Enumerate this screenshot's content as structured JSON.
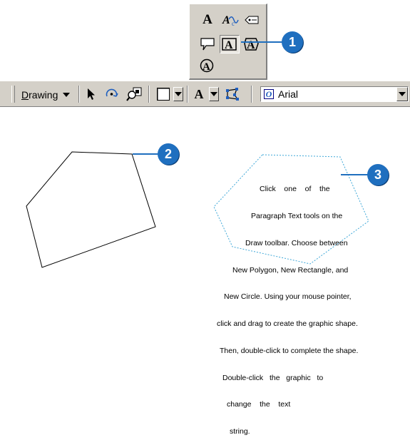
{
  "palette": {
    "tools": [
      {
        "name": "text-tool",
        "glyph": "A"
      },
      {
        "name": "spline-text-tool",
        "glyph": "A"
      },
      {
        "name": "label-tool",
        "icon": "label-tag-icon"
      },
      {
        "name": "callout-tool",
        "icon": "callout-bubble-icon"
      },
      {
        "name": "rectangle-text-tool",
        "glyph": "A",
        "pressed": true
      },
      {
        "name": "polygon-text-tool",
        "glyph": "A"
      },
      {
        "name": "circle-text-tool",
        "glyph": "A"
      }
    ]
  },
  "toolbar": {
    "drawing_label": "Drawing",
    "font_color_glyph": "A",
    "font_name": "Arial"
  },
  "callouts": {
    "one": "1",
    "two": "2",
    "three": "3"
  },
  "paragraph": {
    "lines": [
      "Click    one    of    the",
      "Paragraph Text tools on the",
      "Draw toolbar. Choose between",
      "New Polygon, New Rectangle, and",
      "New Circle. Using your mouse pointer,",
      "click and drag to create the graphic shape.",
      "Then, double-click to complete the shape.",
      "Double-click   the   graphic   to",
      "change    the    text",
      "string."
    ]
  },
  "colors": {
    "callout": "#1f6fbf",
    "dotted_outline": "#3fa8d8",
    "toolbar": "#d4d0c8"
  }
}
